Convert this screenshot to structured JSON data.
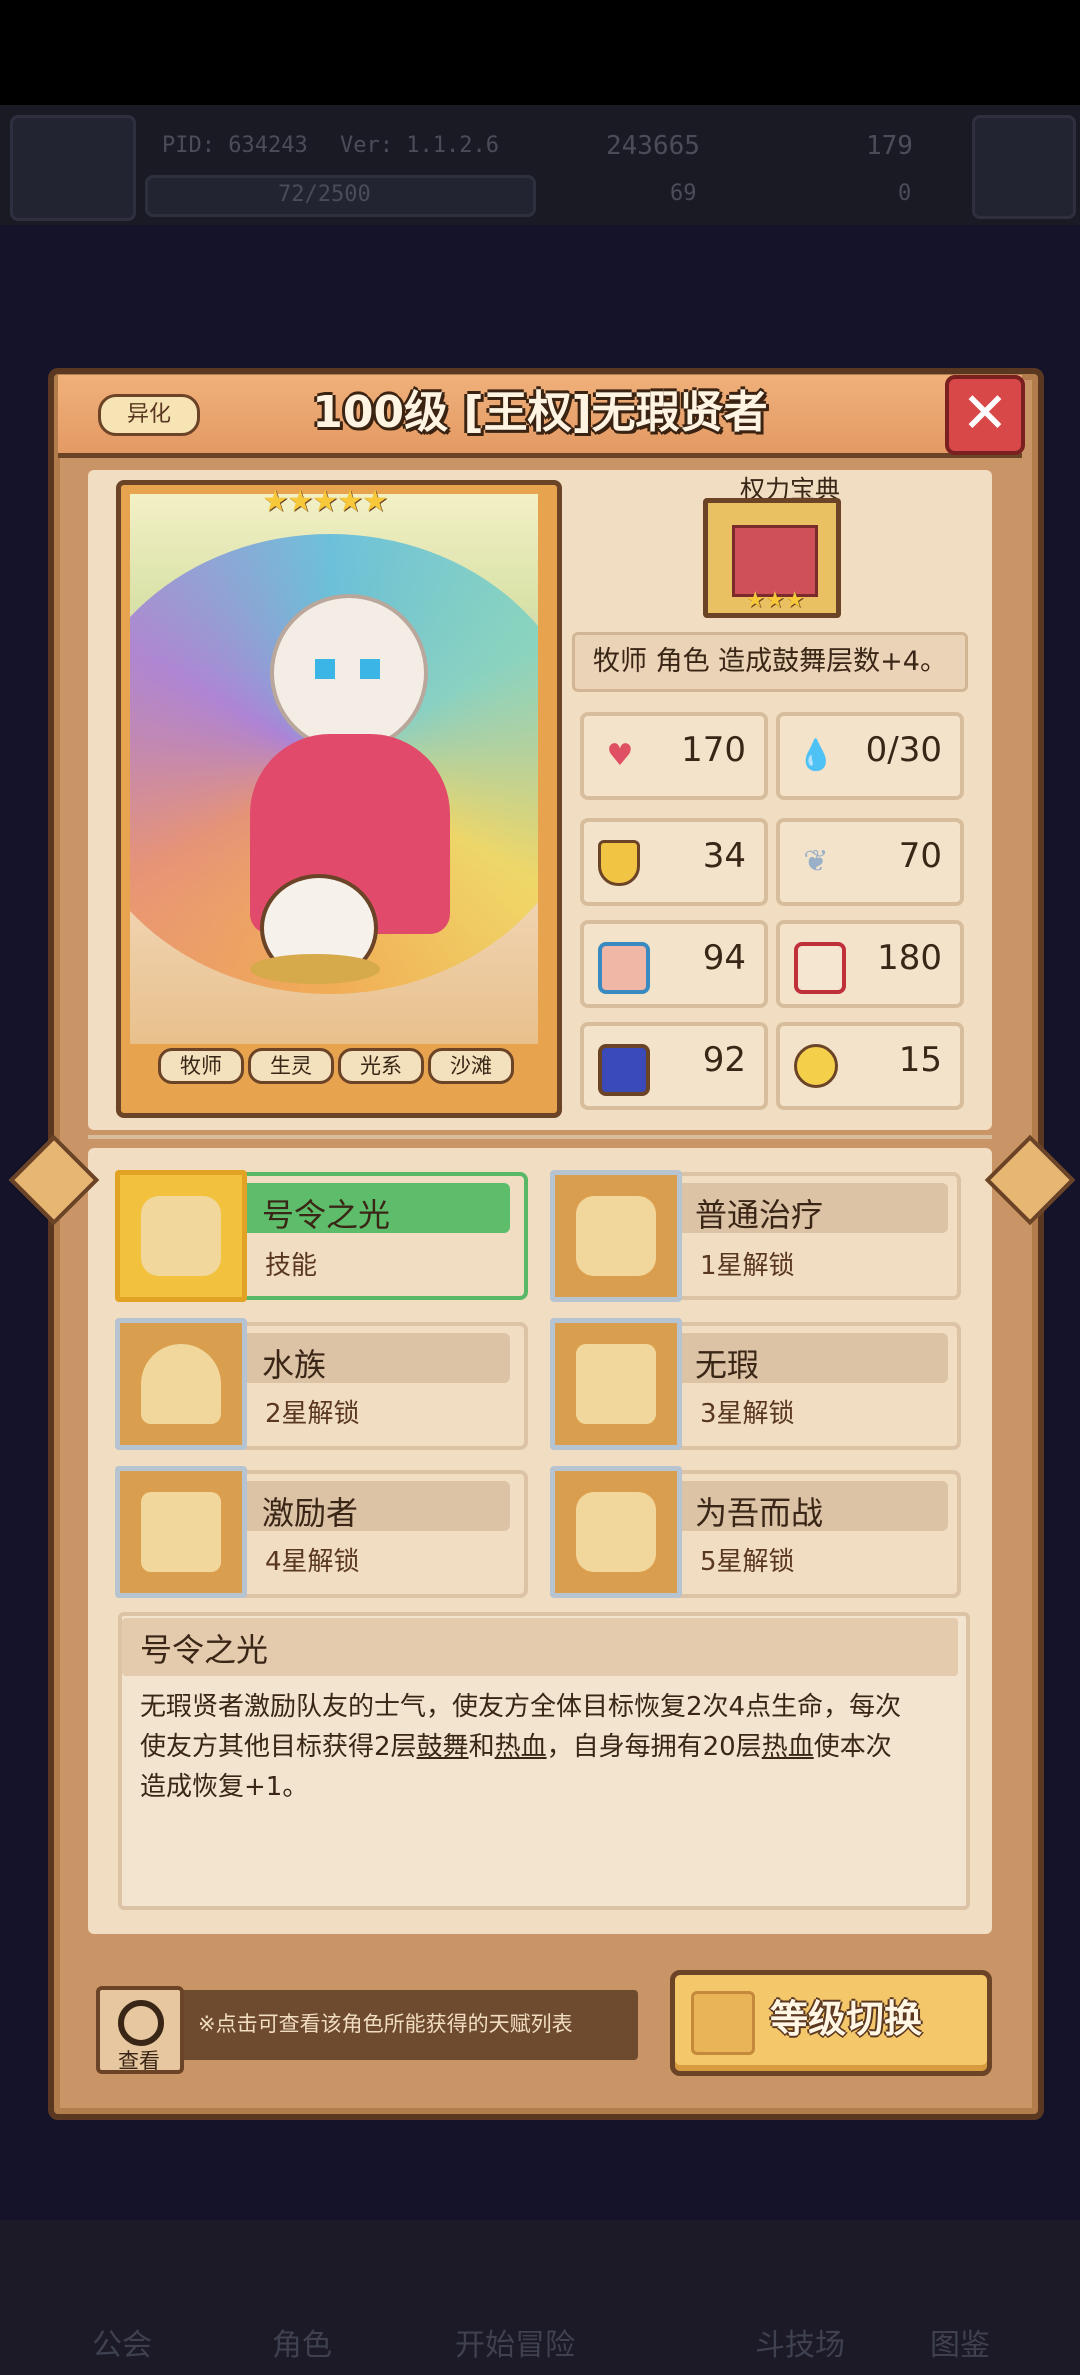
{
  "hud": {
    "pid": "PID: 634243",
    "ver": "Ver: 1.1.2.6",
    "gold": "243665",
    "gems": "179",
    "exp": "72/2500",
    "clover": "69",
    "other": "0"
  },
  "panel": {
    "variant_tag": "异化",
    "title": "100级 [王权]无瑕贤者",
    "close": "✕"
  },
  "card": {
    "stars": "★★★★★",
    "tags": [
      "牧师",
      "生灵",
      "光系",
      "沙滩"
    ]
  },
  "relic": {
    "label": "权力宝典",
    "stars": "★★★",
    "desc": "牧师 角色 造成鼓舞层数+4。"
  },
  "stats": [
    {
      "icon": "heart-icon",
      "value": "170"
    },
    {
      "icon": "drop-icon",
      "value": "0/30"
    },
    {
      "icon": "shield-icon",
      "value": "34"
    },
    {
      "icon": "wing-icon",
      "value": "70"
    },
    {
      "icon": "fist-icon",
      "value": "94"
    },
    {
      "icon": "book-icon",
      "value": "180"
    },
    {
      "icon": "scroll-icon",
      "value": "92"
    },
    {
      "icon": "clock-icon",
      "value": "15"
    }
  ],
  "skills": [
    {
      "name": "号令之光",
      "sub": "技能"
    },
    {
      "name": "普通治疗",
      "sub": "1星解锁"
    },
    {
      "name": "水族",
      "sub": "2星解锁"
    },
    {
      "name": "无瑕",
      "sub": "3星解锁"
    },
    {
      "name": "激励者",
      "sub": "4星解锁"
    },
    {
      "name": "为吾而战",
      "sub": "5星解锁"
    }
  ],
  "detail": {
    "title": "号令之光",
    "line1": "无瑕贤者激励队友的士气，使友方全体目标恢复2次4点生命，每次",
    "line2a": "使友方其他目标获得2层",
    "kw1": "鼓舞",
    "and": "和",
    "kw2": "热血",
    "line2b": "，自身每拥有20层",
    "kw3": "热血",
    "line2c": "使本次",
    "line3": "造成恢复+1。"
  },
  "footer": {
    "view_label": "查看",
    "hint": "※点击可查看该角色所能获得的天赋列表",
    "switch_label": "等级切换"
  },
  "nav": [
    "公会",
    "角色",
    "开始冒险",
    "斗技场",
    "图鉴"
  ]
}
